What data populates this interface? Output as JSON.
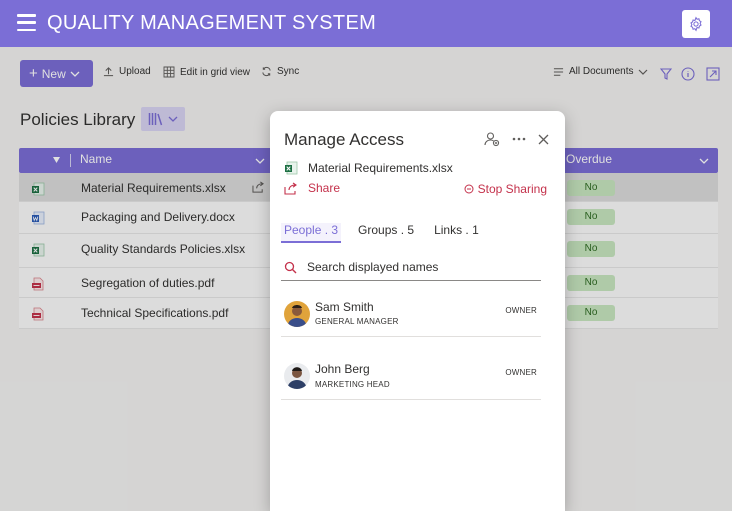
{
  "app": {
    "title": "QUALITY MANAGEMENT SYSTEM",
    "settings_icon": "gear-icon",
    "menu_icon": "hamburger-icon"
  },
  "toolbar": {
    "new_label": "New",
    "upload_label": "Upload",
    "grid_label": "Edit in grid view",
    "sync_label": "Sync",
    "view_label": "All Documents"
  },
  "library": {
    "title": "Policies Library",
    "columns": {
      "name": "Name",
      "overdue": "Overdue"
    },
    "rows": [
      {
        "name": "Material Requirements.xlsx",
        "type": "excel",
        "overdue": "No",
        "selected": true
      },
      {
        "name": "Packaging and Delivery.docx",
        "type": "word",
        "overdue": "No",
        "selected": false
      },
      {
        "name": "Quality Standards Policies.xlsx",
        "type": "excel",
        "overdue": "No",
        "selected": false
      },
      {
        "name": "Segregation of duties.pdf",
        "type": "pdf",
        "overdue": "No",
        "selected": false
      },
      {
        "name": "Technical Specifications.pdf",
        "type": "pdf",
        "overdue": "No",
        "selected": false
      }
    ]
  },
  "panel": {
    "title": "Manage Access",
    "file_name": "Material Requirements.xlsx",
    "share_label": "Share",
    "stop_sharing_label": "Stop Sharing",
    "tabs": [
      {
        "label": "People . 3",
        "active": true
      },
      {
        "label": "Groups . 5",
        "active": false
      },
      {
        "label": "Links . 1",
        "active": false
      }
    ],
    "search_placeholder": "Search displayed names",
    "people": [
      {
        "name": "Sam Smith",
        "title": "GENERAL MANAGER",
        "role": "OWNER"
      },
      {
        "name": "John Berg",
        "title": "MARKETING HEAD",
        "role": "OWNER"
      }
    ]
  },
  "colors": {
    "accent": "#7b6ed6",
    "danger": "#c4314b",
    "status_bg": "#c8e6c0"
  }
}
